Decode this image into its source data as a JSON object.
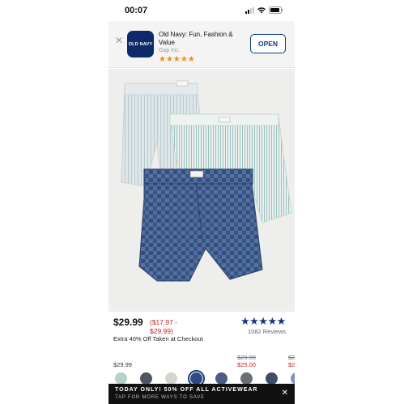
{
  "status": {
    "time": "00:07"
  },
  "banner": {
    "close_icon": "close-icon",
    "app_icon_text": "OLD NAVY",
    "app_name": "Old Navy: Fun, Fashion & Value",
    "publisher": "Gap Inc.",
    "stars": "★★★★★",
    "rating_level": 5,
    "open_label": "OPEN",
    "brand_color": "#0f2a6b",
    "star_color": "#ee8e1c"
  },
  "product": {
    "image_alt": "product-image",
    "sale_price": "$29.99",
    "original_price": "($17.97 - $29.99)",
    "promo_text": "Extra 40% Off Taken at Checkout",
    "rating_stars": "★★★★★",
    "review_count": "1082 Reviews",
    "star_color": "#123b7a",
    "sale_color": "#c42020"
  },
  "price_row": {
    "item1_price": "$29.99",
    "item2_original": "$29.99",
    "item2_sale": "$25.00",
    "item3_original": "$2",
    "item3_sale": "$2"
  },
  "swatches": {
    "colors": [
      "#b8d0ca",
      "#4d5663",
      "#d7d4cf",
      "#2d4c80",
      "#4b5d86",
      "#6a6f78",
      "#3e4d6b",
      "#7e95c2"
    ],
    "selected_index": 3
  },
  "promo_bar": {
    "title": "TODAY ONLY! 50% OFF ALL ACTIVEWEAR",
    "subtitle": "TAP FOR MORE WAYS TO SAVE",
    "close_icon": "close-icon"
  }
}
